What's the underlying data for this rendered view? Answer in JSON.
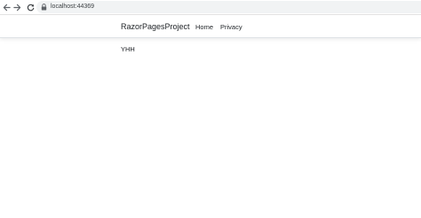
{
  "browser": {
    "url": "localhost:44369"
  },
  "navbar": {
    "brand": "RazorPagesProject",
    "links": [
      {
        "label": "Home"
      },
      {
        "label": "Privacy"
      }
    ]
  },
  "main": {
    "text": "YHH"
  },
  "icons": {
    "back": "arrow-left-icon",
    "forward": "arrow-right-icon",
    "reload": "reload-icon",
    "lock": "lock-icon"
  }
}
